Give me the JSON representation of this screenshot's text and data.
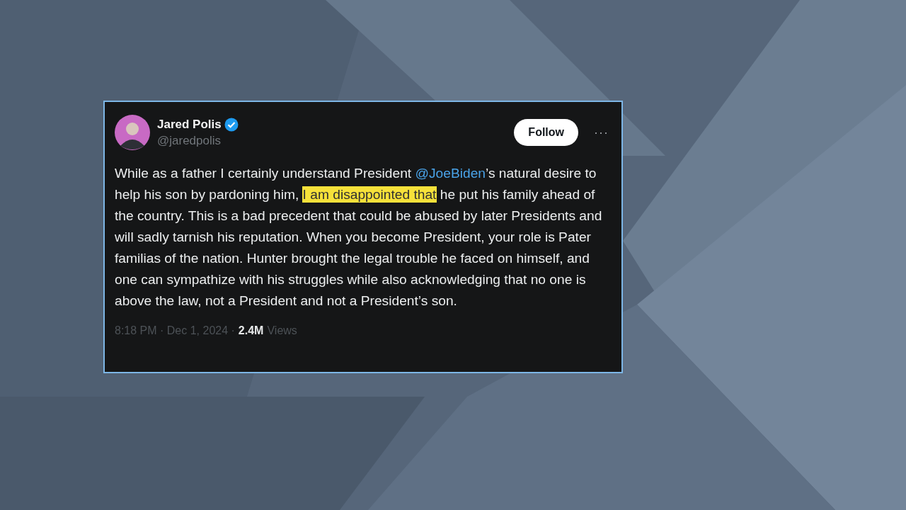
{
  "post": {
    "author": {
      "name": "Jared Polis",
      "verified": true,
      "handle": "@jaredpolis"
    },
    "follow_button": "Follow",
    "more": "···",
    "body": [
      {
        "kind": "text",
        "text": "While as a father I certainly understand President "
      },
      {
        "kind": "mention",
        "text": "@JoeBiden"
      },
      {
        "kind": "text",
        "text": "’s natural desire to help his son by pardoning him, "
      },
      {
        "kind": "highlight",
        "text": "I am disappointed that"
      },
      {
        "kind": "text",
        "text": " he put his family ahead of the country. This is a bad precedent that could be abused by later Presidents and will sadly tarnish his reputation. When you become President, your role is Pater familias of the nation. Hunter brought the legal trouble he faced on himself, and one can sympathize with his struggles while also acknowledging that no one is above the law, not a President and not a President’s son."
      }
    ],
    "timestamp": "8:18 PM · Dec 1, 2024 ·",
    "views_count": "2.4M",
    "views_label": "Views"
  }
}
